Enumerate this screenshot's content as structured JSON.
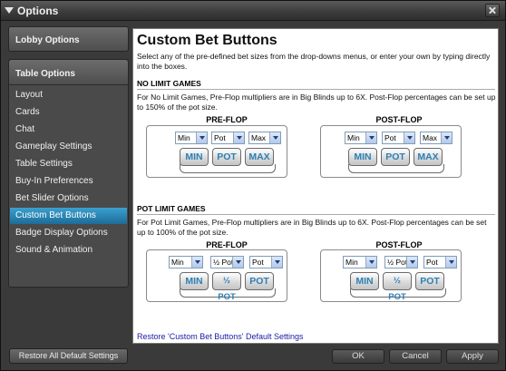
{
  "window": {
    "title": "Options"
  },
  "sidebar": {
    "lobby_options": "Lobby Options",
    "table_options": "Table Options",
    "items": [
      {
        "label": "Layout",
        "active": false
      },
      {
        "label": "Cards",
        "active": false
      },
      {
        "label": "Chat",
        "active": false
      },
      {
        "label": "Gameplay Settings",
        "active": false
      },
      {
        "label": "Table Settings",
        "active": false
      },
      {
        "label": "Buy-In Preferences",
        "active": false
      },
      {
        "label": "Bet Slider Options",
        "active": false
      },
      {
        "label": "Custom Bet Buttons",
        "active": true
      },
      {
        "label": "Badge Display Options",
        "active": false
      },
      {
        "label": "Sound & Animation",
        "active": false
      }
    ],
    "restore_all": "Restore All Default Settings"
  },
  "content": {
    "title": "Custom Bet Buttons",
    "intro": "Select any of the pre-defined bet sizes from the drop-downs menus, or enter your own by typing directly into the boxes.",
    "no_limit": {
      "heading": "NO LIMIT GAMES",
      "desc": "For No Limit Games, Pre-Flop multipliers are in Big Blinds up to 6X. Post-Flop percentages can be set up to 150% of the pot size.",
      "preflop": {
        "label": "PRE-FLOP",
        "selects": [
          "Min",
          "Pot",
          "Max"
        ],
        "buttons": [
          "MIN",
          "POT",
          "MAX"
        ]
      },
      "postflop": {
        "label": "POST-FLOP",
        "selects": [
          "Min",
          "Pot",
          "Max"
        ],
        "buttons": [
          "MIN",
          "POT",
          "MAX"
        ]
      }
    },
    "pot_limit": {
      "heading": "POT LIMIT GAMES",
      "desc": "For Pot Limit Games, Pre-Flop multipliers are in Big Blinds up to 6X. Post-Flop percentages can be set up to 100% of the pot size.",
      "preflop": {
        "label": "PRE-FLOP",
        "selects": [
          "Min",
          "½ Pot",
          "Pot"
        ],
        "buttons": [
          "MIN",
          "½ POT",
          "POT"
        ]
      },
      "postflop": {
        "label": "POST-FLOP",
        "selects": [
          "Min",
          "½ Pot",
          "Pot"
        ],
        "buttons": [
          "MIN",
          "½ POT",
          "POT"
        ]
      }
    },
    "restore_link": "Restore 'Custom Bet Buttons' Default Settings"
  },
  "footer": {
    "ok": "OK",
    "cancel": "Cancel",
    "apply": "Apply"
  },
  "colors": {
    "accent": "#2a86b8",
    "chip_text": "#2e7fb4",
    "link": "#1a1aa8"
  }
}
